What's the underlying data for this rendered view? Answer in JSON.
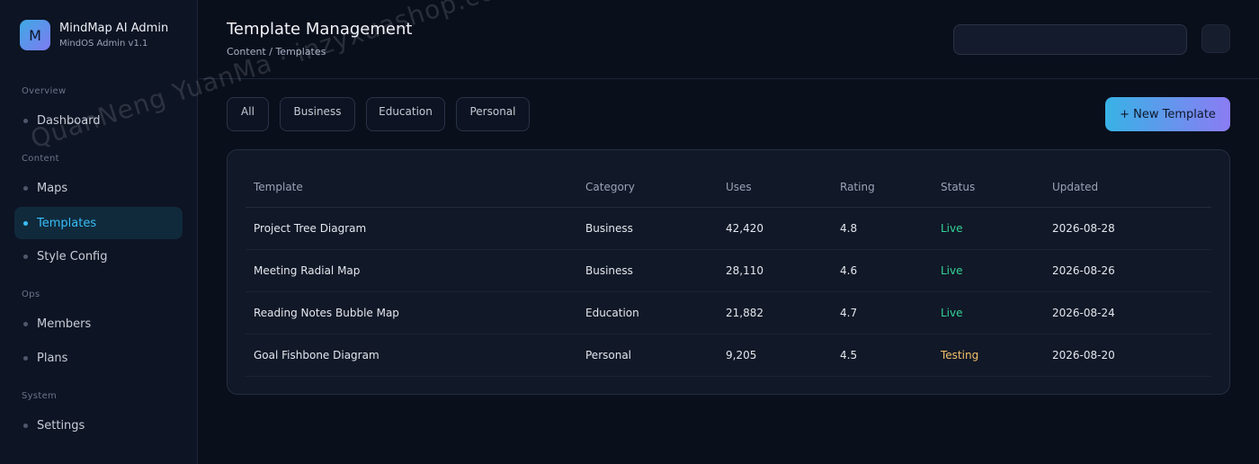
{
  "brand": {
    "logo_letter": "M",
    "title": "MindMap AI Admin",
    "subtitle": "MindOS Admin v1.1"
  },
  "sidebar": {
    "sections": [
      {
        "label": "Overview",
        "items": [
          {
            "label": "Dashboard"
          }
        ]
      },
      {
        "label": "Content",
        "items": [
          {
            "label": "Maps"
          },
          {
            "label": "Templates",
            "active": true
          },
          {
            "label": "Style Config"
          }
        ]
      },
      {
        "label": "Ops",
        "items": [
          {
            "label": "Members"
          },
          {
            "label": "Plans"
          }
        ]
      },
      {
        "label": "System",
        "items": [
          {
            "label": "Settings"
          }
        ]
      }
    ]
  },
  "header": {
    "title": "Template Management",
    "breadcrumb": "Content / Templates",
    "search_value": ""
  },
  "filters": [
    "All",
    "Business",
    "Education",
    "Personal"
  ],
  "new_button_label": "+ New Template",
  "table": {
    "columns": [
      "Template",
      "Category",
      "Uses",
      "Rating",
      "Status",
      "Updated"
    ],
    "rows": [
      {
        "template": "Project Tree Diagram",
        "category": "Business",
        "uses": "42,420",
        "rating": "4.8",
        "status": "Live",
        "updated": "2026-08-28"
      },
      {
        "template": "Meeting Radial Map",
        "category": "Business",
        "uses": "28,110",
        "rating": "4.6",
        "status": "Live",
        "updated": "2026-08-26"
      },
      {
        "template": "Reading Notes Bubble Map",
        "category": "Education",
        "uses": "21,882",
        "rating": "4.7",
        "status": "Live",
        "updated": "2026-08-24"
      },
      {
        "template": "Goal Fishbone Diagram",
        "category": "Personal",
        "uses": "9,205",
        "rating": "4.5",
        "status": "Testing",
        "updated": "2026-08-20"
      }
    ]
  },
  "colors": {
    "accent": "#38bdf8",
    "live": "#34d399",
    "testing": "#f4c16b",
    "background": "#0a0f1c"
  },
  "watermark": "QuanNeng YuanMa · inzyxuashop.com"
}
